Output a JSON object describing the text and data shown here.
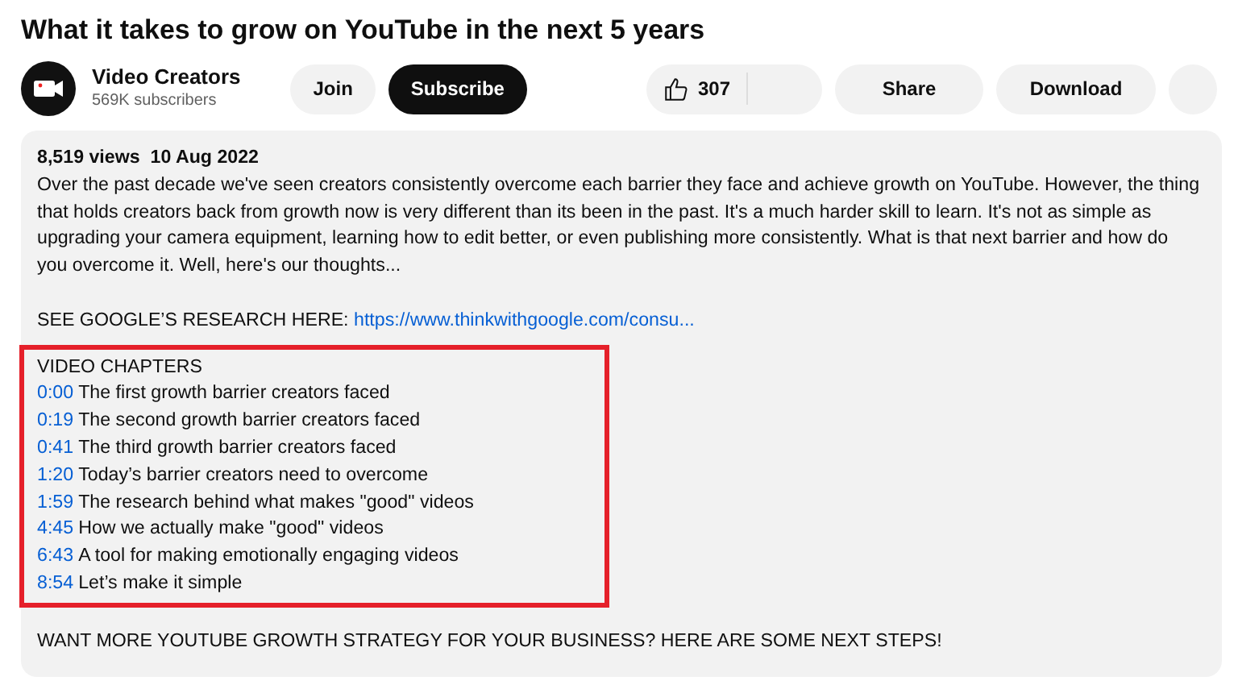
{
  "video_title": "What it takes to grow on YouTube in the next 5 years",
  "channel": {
    "name": "Video Creators",
    "subscribers": "569K subscribers"
  },
  "buttons": {
    "join": "Join",
    "subscribe": "Subscribe",
    "likes": "307",
    "share": "Share",
    "download": "Download"
  },
  "description": {
    "stats": "8,519 views  10 Aug 2022",
    "paragraph": "Over the past decade we've seen creators consistently overcome each barrier they face and achieve growth on YouTube. However, the thing that holds creators back from growth now is very different than its been in the past. It's a much harder skill to learn. It's not as simple as upgrading your camera equipment, learning how to edit better, or even publishing more consistently. What is that next barrier and how do you overcome it. Well, here's our thoughts...",
    "research_label": "SEE GOOGLE’S RESEARCH HERE:",
    "research_link": "https://www.thinkwithgoogle.com/consu...",
    "chapters_heading": "VIDEO CHAPTERS",
    "chapters": [
      {
        "time": "0:00",
        "title": "The first growth barrier creators faced"
      },
      {
        "time": "0:19",
        "title": "The second growth barrier creators faced"
      },
      {
        "time": "0:41",
        "title": "The third growth barrier creators faced"
      },
      {
        "time": "1:20",
        "title": "Today’s barrier creators need to overcome"
      },
      {
        "time": "1:59",
        "title": "The research behind what makes \"good\" videos"
      },
      {
        "time": "4:45",
        "title": "How we actually make \"good\" videos"
      },
      {
        "time": "6:43",
        "title": "A tool for making emotionally engaging videos"
      },
      {
        "time": "8:54",
        "title": "Let’s make it simple"
      }
    ],
    "closing": "WANT MORE YOUTUBE GROWTH STRATEGY FOR YOUR BUSINESS? HERE ARE SOME NEXT STEPS!"
  }
}
